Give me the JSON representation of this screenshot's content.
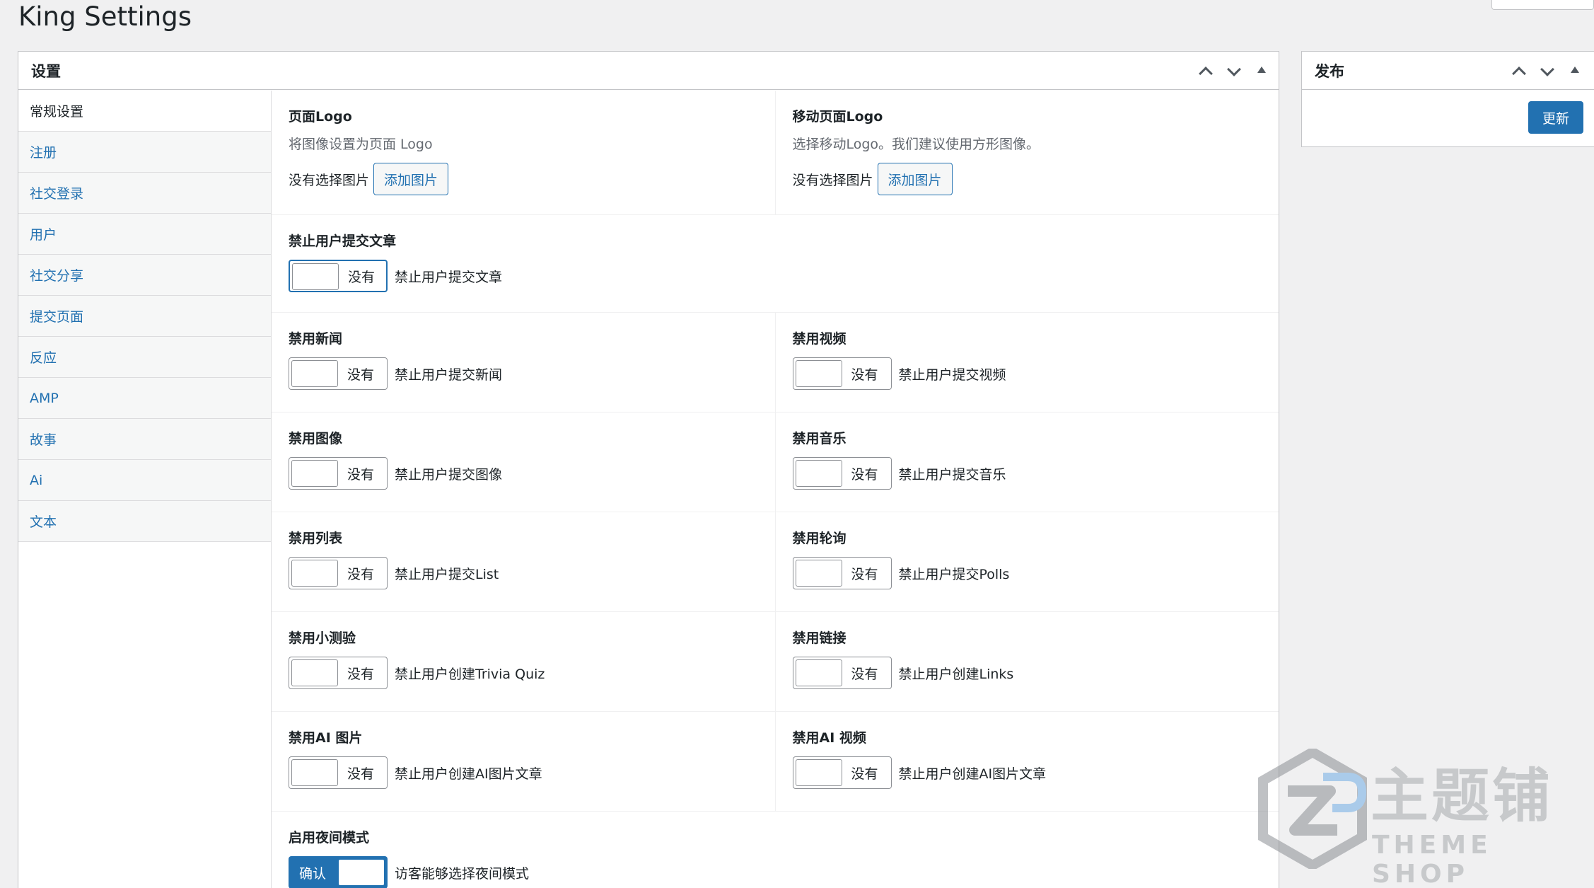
{
  "page": {
    "title": "King Settings"
  },
  "settings_box": {
    "title": "设置"
  },
  "publish_box": {
    "title": "发布",
    "update_label": "更新"
  },
  "tabs": [
    {
      "label": "常规设置"
    },
    {
      "label": "注册"
    },
    {
      "label": "社交登录"
    },
    {
      "label": "用户"
    },
    {
      "label": "社交分享"
    },
    {
      "label": "提交页面"
    },
    {
      "label": "反应"
    },
    {
      "label": "AMP"
    },
    {
      "label": "故事"
    },
    {
      "label": "Ai"
    },
    {
      "label": "文本"
    }
  ],
  "logo": {
    "page": {
      "label": "页面Logo",
      "desc": "将图像设置为页面 Logo",
      "status": "没有选择图片",
      "button": "添加图片"
    },
    "mobile": {
      "label": "移动页面Logo",
      "desc": "选择移动Logo。我们建议使用方形图像。",
      "status": "没有选择图片",
      "button": "添加图片"
    }
  },
  "fields": {
    "posts": {
      "label": "禁止用户提交文章",
      "toggle": "没有",
      "desc": "禁止用户提交文章"
    },
    "news": {
      "label": "禁用新闻",
      "toggle": "没有",
      "desc": "禁止用户提交新闻"
    },
    "video": {
      "label": "禁用视频",
      "toggle": "没有",
      "desc": "禁止用户提交视频"
    },
    "image": {
      "label": "禁用图像",
      "toggle": "没有",
      "desc": "禁止用户提交图像"
    },
    "music": {
      "label": "禁用音乐",
      "toggle": "没有",
      "desc": "禁止用户提交音乐"
    },
    "list": {
      "label": "禁用列表",
      "toggle": "没有",
      "desc": "禁止用户提交List"
    },
    "polls": {
      "label": "禁用轮询",
      "toggle": "没有",
      "desc": "禁止用户提交Polls"
    },
    "quiz": {
      "label": "禁用小测验",
      "toggle": "没有",
      "desc": "禁止用户创建Trivia Quiz"
    },
    "links": {
      "label": "禁用链接",
      "toggle": "没有",
      "desc": "禁止用户创建Links"
    },
    "ai_image": {
      "label": "禁用AI 图片",
      "toggle": "没有",
      "desc": "禁止用户创建AI图片文章"
    },
    "ai_video": {
      "label": "禁用AI 视频",
      "toggle": "没有",
      "desc": "禁止用户创建AI图片文章"
    },
    "night": {
      "label": "启用夜间模式",
      "toggle": "确认",
      "desc": "访客能够选择夜间模式"
    }
  },
  "watermark": {
    "text": "主题铺",
    "sub": "THEME SHOP"
  }
}
